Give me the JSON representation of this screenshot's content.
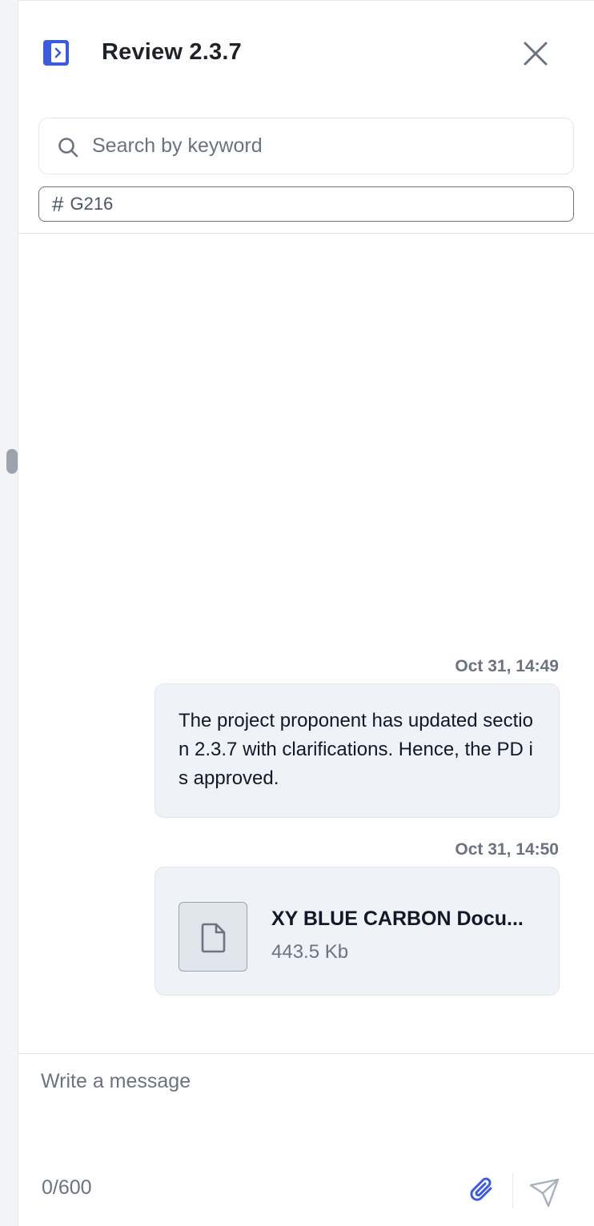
{
  "header": {
    "title": "Review 2.3.7"
  },
  "search": {
    "placeholder": "Search by keyword",
    "value": ""
  },
  "filter_tag": {
    "symbol": "#",
    "label": "G216"
  },
  "messages": [
    {
      "timestamp": "Oct 31, 14:49",
      "text": "The project proponent has updated section 2.3.7 with clarifications. Hence, the PD is approved."
    },
    {
      "timestamp": "Oct 31, 14:50",
      "file_name": "XY BLUE CARBON Docu...",
      "file_size": "443.5 Kb"
    }
  ],
  "composer": {
    "placeholder": "Write a message",
    "char_count": "0/600"
  },
  "icons": {
    "collapse": "sidebar-collapse-icon",
    "close": "close-icon",
    "search": "search-icon",
    "file": "file-icon",
    "attach": "paperclip-icon",
    "send": "send-icon"
  },
  "colors": {
    "accent": "#3b5bdb",
    "bubble": "#eff2f7",
    "muted_text": "#6b7280"
  }
}
